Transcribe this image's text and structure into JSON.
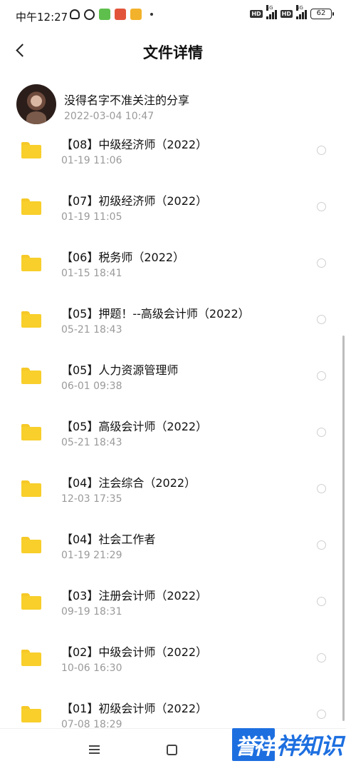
{
  "status_bar": {
    "time": "中午12:27",
    "battery": "62",
    "network": "4G",
    "hd_label": "HD"
  },
  "header": {
    "title": "文件详情"
  },
  "share": {
    "sharer_name": "没得名字不准关注的分享",
    "share_time": "2022-03-04  10:47"
  },
  "files": [
    {
      "name": "【08】中级经济师（2022）",
      "time": "01-19  11:06"
    },
    {
      "name": "【07】初级经济师（2022）",
      "time": "01-19  11:05"
    },
    {
      "name": "【06】税务师（2022）",
      "time": "01-15  18:41"
    },
    {
      "name": "【05】押题！--高级会计师（2022）",
      "time": "05-21  18:43"
    },
    {
      "name": "【05】人力资源管理师",
      "time": "06-01  09:38"
    },
    {
      "name": "【05】高级会计师（2022）",
      "time": "05-21  18:43"
    },
    {
      "name": "【04】注会综合（2022）",
      "time": "12-03  17:35"
    },
    {
      "name": "【04】社会工作者",
      "time": "01-19  21:29"
    },
    {
      "name": "【03】注册会计师（2022）",
      "time": "09-19  18:31"
    },
    {
      "name": "【02】中级会计师（2022）",
      "time": "10-06  16:30"
    },
    {
      "name": "【01】初级会计师（2022）",
      "time": "07-08  18:29"
    }
  ],
  "watermark": {
    "logo": "誉祥",
    "text": "祥知识"
  },
  "colors": {
    "folder": "#f8cf2b",
    "secondary_text": "#9a9a9a",
    "watermark": "#1d6fe0"
  }
}
